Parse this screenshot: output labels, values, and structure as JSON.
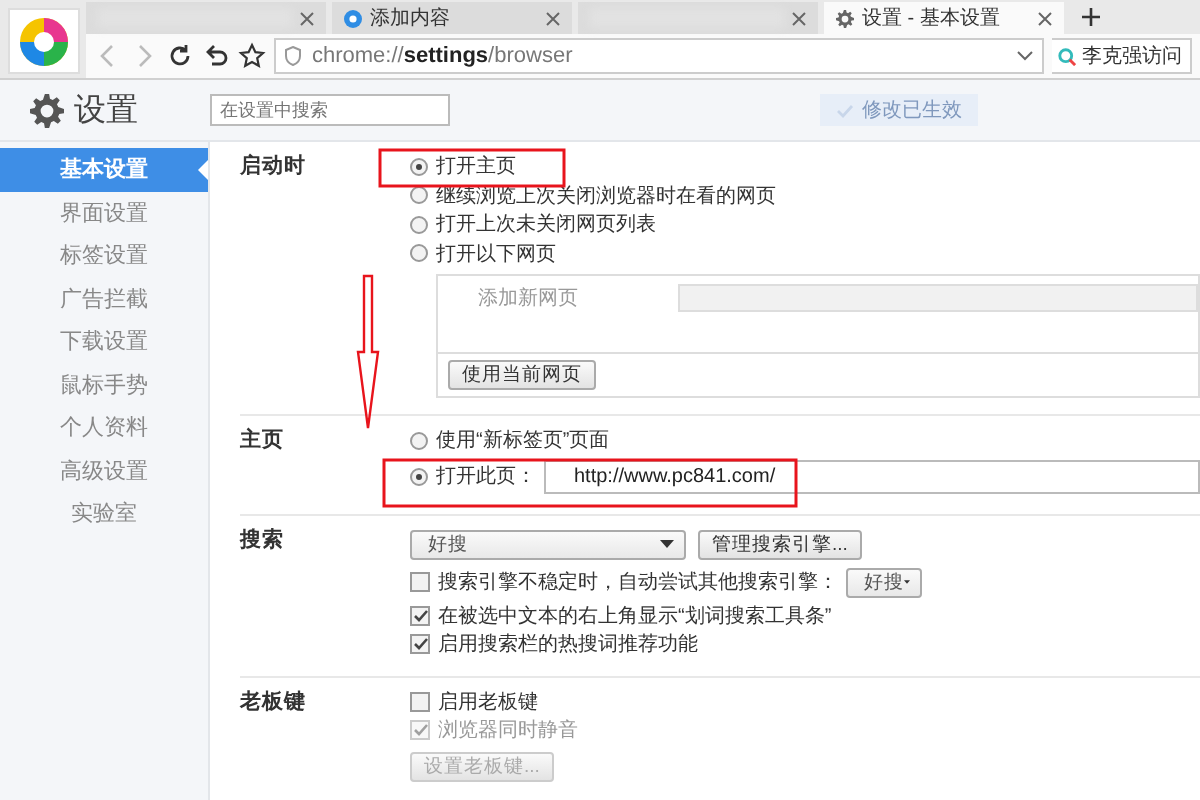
{
  "browser": {
    "tabs": [
      {
        "kind": "blurred",
        "selected": false
      },
      {
        "kind": "page",
        "title": "添加内容",
        "selected": false
      },
      {
        "kind": "blurred",
        "selected": false
      },
      {
        "kind": "settings",
        "title": "设置 - 基本设置",
        "selected": true
      }
    ],
    "address": "chrome://**settings**/browser",
    "search_value": "李克强访问"
  },
  "toast": "修改已生效",
  "settings": {
    "title": "设置",
    "search_placeholder": "在设置中搜索"
  },
  "sidebar": {
    "items": [
      {
        "label": "基本设置",
        "selected": true
      },
      {
        "label": "界面设置",
        "selected": false
      },
      {
        "label": "标签设置",
        "selected": false
      },
      {
        "label": "广告拦截",
        "selected": false
      },
      {
        "label": "下载设置",
        "selected": false
      },
      {
        "label": "鼠标手势",
        "selected": false
      },
      {
        "label": "个人资料",
        "selected": false
      },
      {
        "label": "高级设置",
        "selected": false
      },
      {
        "label": "实验室",
        "selected": false
      }
    ]
  },
  "sections": [
    {
      "label": "启动时",
      "rows": [
        {
          "kind": "radio",
          "label": "打开主页",
          "selected": true
        },
        {
          "kind": "radio",
          "label": "继续浏览上次关闭浏览器时在看的网页",
          "selected": false
        },
        {
          "kind": "radio",
          "label": "打开上次未关闭网页列表",
          "selected": false
        },
        {
          "kind": "radio",
          "label": "打开以下网页",
          "selected": false
        },
        {
          "kind": "pages",
          "new_page": "添加新网页",
          "button": "使用当前网页"
        }
      ]
    },
    {
      "label": "主页",
      "rows": [
        {
          "kind": "radio",
          "label": "使用“新标签页”页面",
          "selected": false
        },
        {
          "kind": "radio_url",
          "label": "打开此页：",
          "value": "http://www.pc841.com/",
          "selected": true
        }
      ]
    },
    {
      "label": "搜索",
      "rows": [
        {
          "kind": "engine",
          "select": "好搜",
          "button": "管理搜索引擎..."
        },
        {
          "kind": "checkbox",
          "label": "搜索引擎不稳定时，自动尝试其他搜索引擎：",
          "select": "好搜",
          "checked": false,
          "disabled": false
        },
        {
          "kind": "checkbox",
          "label": "在被选中文本的右上角显示“划词搜索工具条”",
          "checked": true,
          "disabled": false
        },
        {
          "kind": "checkbox",
          "label": "启用搜索栏的热搜词推荐功能",
          "checked": true,
          "disabled": false
        }
      ]
    },
    {
      "label": "老板键",
      "rows": [
        {
          "kind": "checkbox",
          "label": "启用老板键",
          "checked": false,
          "disabled": false
        },
        {
          "kind": "checkbox",
          "label": "浏览器同时静音",
          "checked": true,
          "disabled": true
        },
        {
          "kind": "button",
          "label": "设置老板键...",
          "disabled": true
        }
      ]
    }
  ]
}
